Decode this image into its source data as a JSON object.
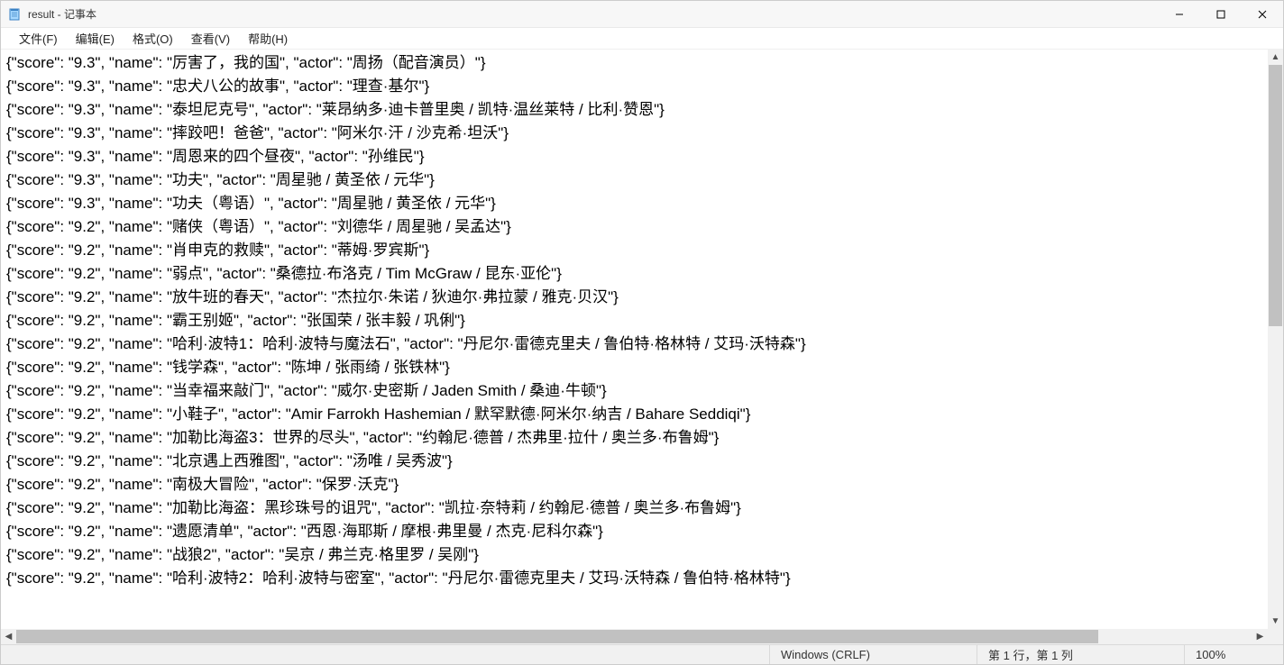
{
  "window": {
    "title": "result - 记事本"
  },
  "menubar": {
    "file": "文件(F)",
    "edit": "编辑(E)",
    "format": "格式(O)",
    "view": "查看(V)",
    "help": "帮助(H)"
  },
  "content_lines": [
    "{\"score\": \"9.3\", \"name\": \"厉害了，我的国\", \"actor\": \"周扬（配音演员）\"}",
    "{\"score\": \"9.3\", \"name\": \"忠犬八公的故事\", \"actor\": \"理查·基尔\"}",
    "{\"score\": \"9.3\", \"name\": \"泰坦尼克号\", \"actor\": \"莱昂纳多·迪卡普里奥 / 凯特·温丝莱特 / 比利·赞恩\"}",
    "{\"score\": \"9.3\", \"name\": \"摔跤吧！爸爸\", \"actor\": \"阿米尔·汗 / 沙克希·坦沃\"}",
    "{\"score\": \"9.3\", \"name\": \"周恩来的四个昼夜\", \"actor\": \"孙维民\"}",
    "{\"score\": \"9.3\", \"name\": \"功夫\", \"actor\": \"周星驰 / 黄圣依 / 元华\"}",
    "{\"score\": \"9.3\", \"name\": \"功夫（粤语）\", \"actor\": \"周星驰 / 黄圣依 / 元华\"}",
    "{\"score\": \"9.2\", \"name\": \"赌侠（粤语）\", \"actor\": \"刘德华 / 周星驰 / 吴孟达\"}",
    "{\"score\": \"9.2\", \"name\": \"肖申克的救赎\", \"actor\": \"蒂姆·罗宾斯\"}",
    "{\"score\": \"9.2\", \"name\": \"弱点\", \"actor\": \"桑德拉·布洛克 / Tim McGraw / 昆东·亚伦\"}",
    "{\"score\": \"9.2\", \"name\": \"放牛班的春天\", \"actor\": \"杰拉尔·朱诺 / 狄迪尔·弗拉蒙 / 雅克·贝汉\"}",
    "{\"score\": \"9.2\", \"name\": \"霸王别姬\", \"actor\": \"张国荣 / 张丰毅 / 巩俐\"}",
    "{\"score\": \"9.2\", \"name\": \"哈利·波特1：哈利·波特与魔法石\", \"actor\": \"丹尼尔·雷德克里夫 / 鲁伯特·格林特 / 艾玛·沃特森\"}",
    "{\"score\": \"9.2\", \"name\": \"钱学森\", \"actor\": \"陈坤 / 张雨绮 / 张铁林\"}",
    "{\"score\": \"9.2\", \"name\": \"当幸福来敲门\", \"actor\": \"威尔·史密斯 / Jaden Smith / 桑迪·牛顿\"}",
    "{\"score\": \"9.2\", \"name\": \"小鞋子\", \"actor\": \"Amir Farrokh Hashemian / 默罕默德·阿米尔·纳吉 / Bahare Seddiqi\"}",
    "{\"score\": \"9.2\", \"name\": \"加勒比海盗3：世界的尽头\", \"actor\": \"约翰尼·德普 / 杰弗里·拉什 / 奥兰多·布鲁姆\"}",
    "{\"score\": \"9.2\", \"name\": \"北京遇上西雅图\", \"actor\": \"汤唯 / 吴秀波\"}",
    "{\"score\": \"9.2\", \"name\": \"南极大冒险\", \"actor\": \"保罗·沃克\"}",
    "{\"score\": \"9.2\", \"name\": \"加勒比海盗：黑珍珠号的诅咒\", \"actor\": \"凯拉·奈特莉 / 约翰尼·德普 / 奥兰多·布鲁姆\"}",
    "{\"score\": \"9.2\", \"name\": \"遗愿清单\", \"actor\": \"西恩·海耶斯 / 摩根·弗里曼 / 杰克·尼科尔森\"}",
    "{\"score\": \"9.2\", \"name\": \"战狼2\", \"actor\": \"吴京 / 弗兰克·格里罗 / 吴刚\"}",
    "{\"score\": \"9.2\", \"name\": \"哈利·波特2：哈利·波特与密室\", \"actor\": \"丹尼尔·雷德克里夫 / 艾玛·沃特森 / 鲁伯特·格林特\"}"
  ],
  "statusbar": {
    "line_ending": "Windows (CRLF)",
    "position": "第 1 行，第 1 列",
    "zoom": "100%"
  }
}
